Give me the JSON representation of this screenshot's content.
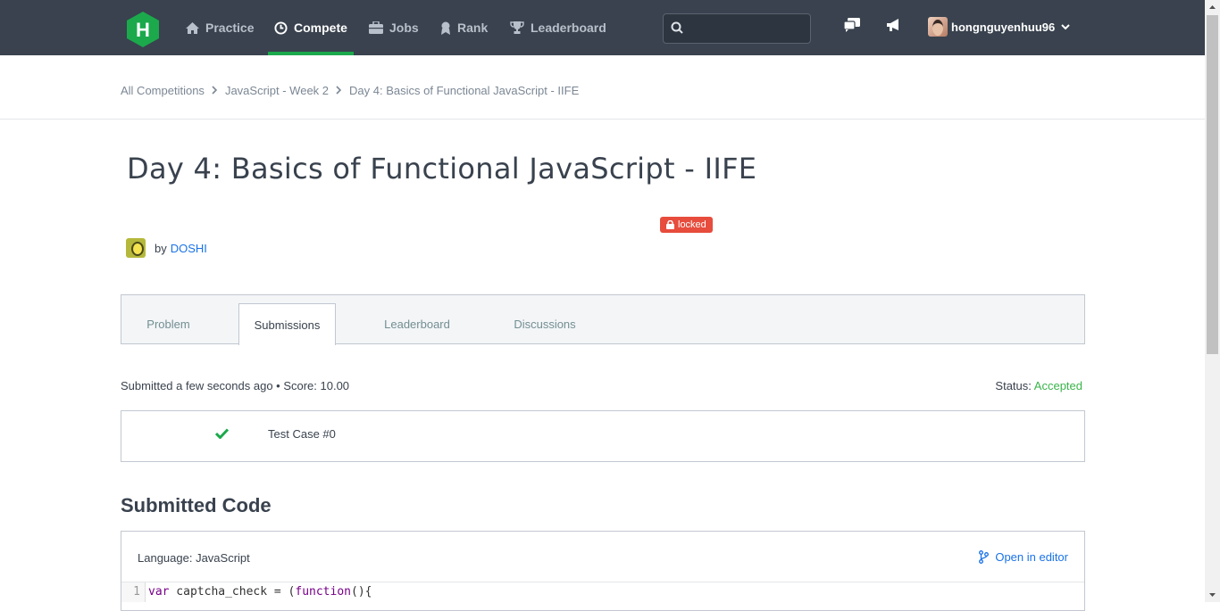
{
  "nav": {
    "logo": "H",
    "items": [
      {
        "label": "Practice",
        "icon": "home-icon"
      },
      {
        "label": "Compete",
        "icon": "clock-icon",
        "active": true
      },
      {
        "label": "Jobs",
        "icon": "briefcase-icon"
      },
      {
        "label": "Rank",
        "icon": "medal-icon"
      },
      {
        "label": "Leaderboard",
        "icon": "trophy-icon"
      }
    ],
    "search_placeholder": "",
    "username": "hongnguyenhuu96"
  },
  "breadcrumb": [
    "All Competitions",
    "JavaScript - Week 2",
    "Day 4: Basics of Functional JavaScript - IIFE"
  ],
  "challenge": {
    "title": "Day 4: Basics of Functional JavaScript - IIFE",
    "badge": "locked",
    "by": "by",
    "author": "DOSHI"
  },
  "tabs": [
    "Problem",
    "Submissions",
    "Leaderboard",
    "Discussions"
  ],
  "submission": {
    "summary": "Submitted a few seconds ago • Score: 10.00",
    "status_label": "Status:",
    "status_value": "Accepted",
    "test_case": "Test Case #0"
  },
  "code": {
    "heading": "Submitted Code",
    "language": "Language: JavaScript",
    "open_editor": "Open in editor",
    "lines": [
      {
        "no": "1",
        "text": "var captcha_check = (function(){"
      }
    ]
  },
  "colors": {
    "nav_bg": "#39424e",
    "accent_green": "#1ba94c",
    "accepted": "#39b44a",
    "link": "#1a73e8",
    "locked": "#e74c3c"
  }
}
